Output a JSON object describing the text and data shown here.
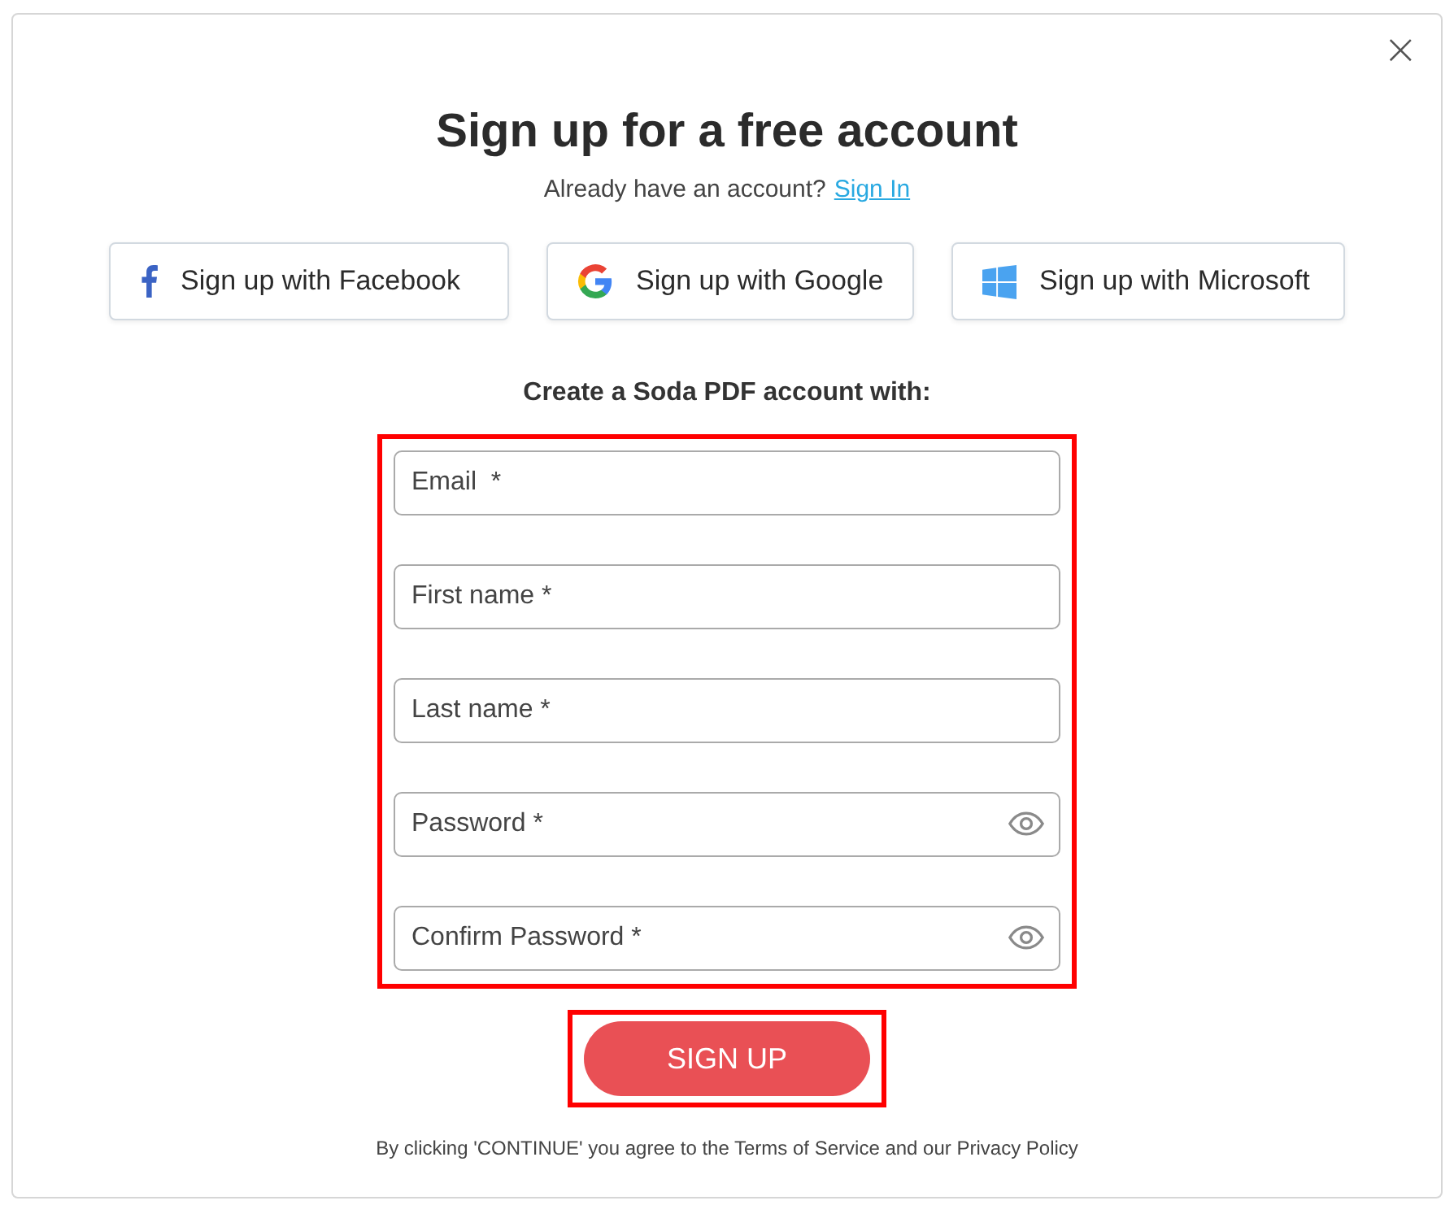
{
  "dialog": {
    "title": "Sign up for a free account",
    "signin_prompt": "Already have an account?",
    "signin_link": "Sign In",
    "close": "×"
  },
  "social_buttons": [
    {
      "kind": "facebook",
      "label": "Sign up with Facebook"
    },
    {
      "kind": "google",
      "label": "Sign up with Google"
    },
    {
      "kind": "microsoft",
      "label": "Sign up with Microsoft"
    }
  ],
  "form": {
    "heading": "Create a Soda PDF account with:",
    "highlighted": true,
    "fields": [
      {
        "placeholder": "Email  *",
        "kind": "text"
      },
      {
        "placeholder": "First name *",
        "kind": "text"
      },
      {
        "placeholder": "Last name *",
        "kind": "text"
      },
      {
        "placeholder": "Password *",
        "kind": "password"
      },
      {
        "placeholder": "Confirm Password *",
        "kind": "password"
      }
    ]
  },
  "submit": {
    "label": "SIGN UP",
    "highlighted": true
  },
  "legal": "By clicking 'CONTINUE' you agree to the Terms of Service and our Privacy Policy"
}
